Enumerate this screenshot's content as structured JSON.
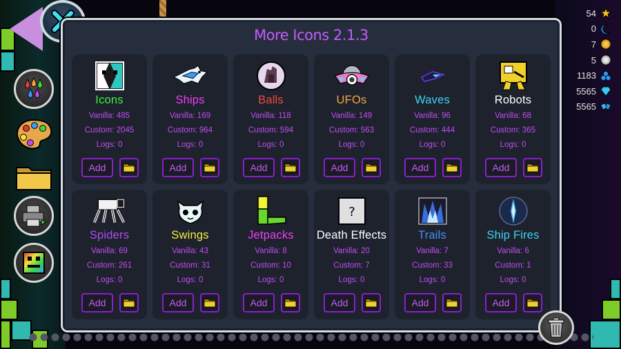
{
  "title": "More Icons 2.1.3",
  "stats": [
    {
      "value": "54",
      "icon": "star-icon",
      "color": "#f2c21a"
    },
    {
      "value": "0",
      "icon": "moon-icon",
      "color": "#2b8cf0"
    },
    {
      "value": "7",
      "icon": "gold-coin-icon",
      "color": "#e0a020"
    },
    {
      "value": "5",
      "icon": "silver-coin-icon",
      "color": "#c8c8c8"
    },
    {
      "value": "1183",
      "icon": "orbs-icon",
      "color": "#2a9af0"
    },
    {
      "value": "5565",
      "icon": "diamond-icon",
      "color": "#35c8f5"
    },
    {
      "value": "5565",
      "icon": "diamond-shards-icon",
      "color": "#35b8f5"
    }
  ],
  "labels": {
    "vanilla": "Vanilla: ",
    "custom": "Custom: ",
    "logs": "Logs: ",
    "add": "Add"
  },
  "categories": [
    {
      "name": "Icons",
      "color": "#42f23d",
      "vanilla": "485",
      "custom": "2045",
      "logs": "0",
      "icon": "cube-icon"
    },
    {
      "name": "Ships",
      "color": "#f23ef5",
      "vanilla": "169",
      "custom": "964",
      "logs": "0",
      "icon": "ship-icon"
    },
    {
      "name": "Balls",
      "color": "#f5493c",
      "vanilla": "118",
      "custom": "594",
      "logs": "0",
      "icon": "ball-icon"
    },
    {
      "name": "UFOs",
      "color": "#f5a83c",
      "vanilla": "149",
      "custom": "563",
      "logs": "0",
      "icon": "ufo-icon"
    },
    {
      "name": "Waves",
      "color": "#3cd4f5",
      "vanilla": "96",
      "custom": "444",
      "logs": "0",
      "icon": "wave-icon"
    },
    {
      "name": "Robots",
      "color": "#ffffff",
      "vanilla": "68",
      "custom": "365",
      "logs": "0",
      "icon": "robot-icon"
    },
    {
      "name": "Spiders",
      "color": "#b04cf5",
      "vanilla": "69",
      "custom": "261",
      "logs": "0",
      "icon": "spider-icon"
    },
    {
      "name": "Swings",
      "color": "#f5ee3c",
      "vanilla": "43",
      "custom": "31",
      "logs": "0",
      "icon": "swing-icon"
    },
    {
      "name": "Jetpacks",
      "color": "#f23ef5",
      "vanilla": "8",
      "custom": "10",
      "logs": "0",
      "icon": "jetpack-icon"
    },
    {
      "name": "Death Effects",
      "color": "#ffffff",
      "vanilla": "20",
      "custom": "7",
      "logs": "0",
      "icon": "question-icon"
    },
    {
      "name": "Trails",
      "color": "#4a8df5",
      "vanilla": "7",
      "custom": "33",
      "logs": "0",
      "icon": "trail-icon"
    },
    {
      "name": "Ship Fires",
      "color": "#3cd4f5",
      "vanilla": "6",
      "custom": "1",
      "logs": "0",
      "icon": "ship-fire-icon"
    }
  ]
}
